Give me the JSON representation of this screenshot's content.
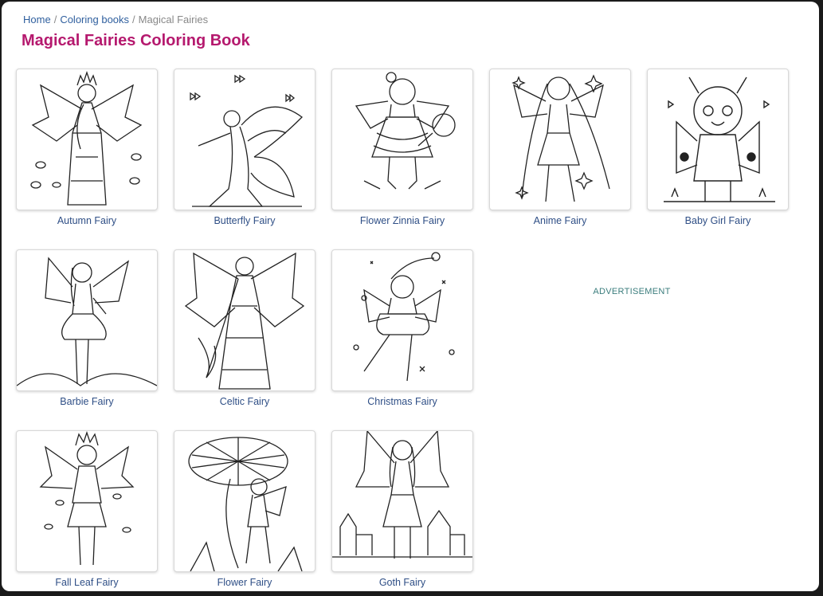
{
  "breadcrumb": {
    "home": "Home",
    "separator": "/",
    "category": "Coloring books",
    "current": "Magical Fairies"
  },
  "page": {
    "title": "Magical Fairies Coloring Book"
  },
  "items": [
    {
      "title": "Autumn Fairy",
      "image_icon": "autumn-fairy-drawing-icon"
    },
    {
      "title": "Butterfly Fairy",
      "image_icon": "butterfly-fairy-drawing-icon"
    },
    {
      "title": "Flower Zinnia Fairy",
      "image_icon": "flower-zinnia-fairy-drawing-icon"
    },
    {
      "title": "Anime Fairy",
      "image_icon": "anime-fairy-drawing-icon"
    },
    {
      "title": "Baby Girl Fairy",
      "image_icon": "baby-girl-fairy-drawing-icon"
    },
    {
      "title": "Barbie Fairy",
      "image_icon": "barbie-fairy-drawing-icon"
    },
    {
      "title": "Celtic Fairy",
      "image_icon": "celtic-fairy-drawing-icon"
    },
    {
      "title": "Christmas Fairy",
      "image_icon": "christmas-fairy-drawing-icon"
    },
    {
      "title": "Fall Leaf Fairy",
      "image_icon": "fall-leaf-fairy-drawing-icon"
    },
    {
      "title": "Flower Fairy",
      "image_icon": "flower-fairy-drawing-icon"
    },
    {
      "title": "Goth Fairy",
      "image_icon": "goth-fairy-drawing-icon"
    }
  ],
  "advertisement": {
    "label": "ADVERTISEMENT"
  },
  "colors": {
    "title": "#b5196e",
    "link": "#2f5f9e",
    "caption": "#2f4f86",
    "ad_label": "#3b7d7d"
  }
}
